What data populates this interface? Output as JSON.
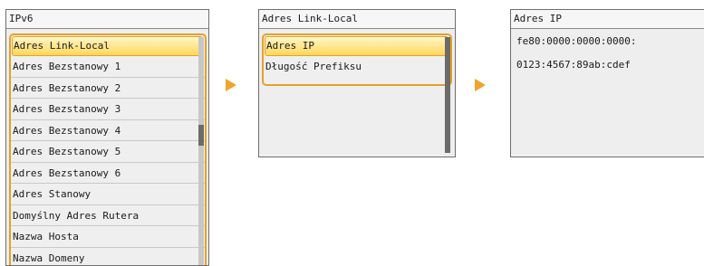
{
  "screens": {
    "ipv6": {
      "title": "IPv6",
      "items": [
        "Adres Link-Local",
        "Adres Bezstanowy 1",
        "Adres Bezstanowy 2",
        "Adres Bezstanowy 3",
        "Adres Bezstanowy 4",
        "Adres Bezstanowy 5",
        "Adres Bezstanowy 6",
        "Adres Stanowy",
        "Domyślny Adres Rutera",
        "Nazwa Hosta",
        "Nazwa Domeny"
      ],
      "selected_index": 0
    },
    "link_local": {
      "title": "Adres Link-Local",
      "items": [
        "Adres IP",
        "Długość Prefiksu"
      ],
      "selected_index": 0
    },
    "ip_address": {
      "title": "Adres IP",
      "lines": [
        "fe80:0000:0000:0000:",
        "0123:4567:89ab:cdef"
      ]
    }
  },
  "icons": {
    "step_arrow": "right-triangle-icon",
    "arrow_color": "#f0a42a",
    "highlight_color": "#e6a126"
  }
}
